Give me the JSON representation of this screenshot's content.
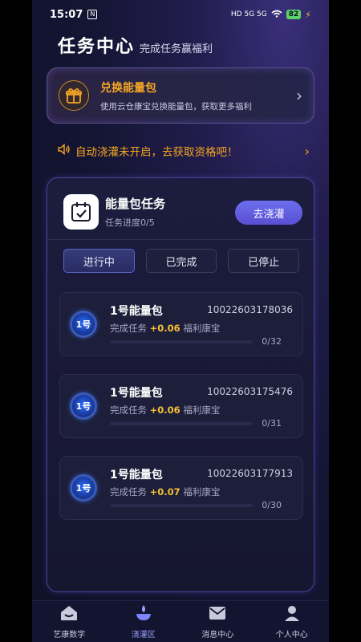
{
  "status": {
    "time": "15:07",
    "badge": "N",
    "signal": "HD 5G 5G",
    "battery": "82"
  },
  "header": {
    "title": "任务中心",
    "subtitle": "完成任务赢福利"
  },
  "exchange": {
    "title": "兑换能量包",
    "desc": "使用云仓康宝兑换能量包，获取更多福利"
  },
  "notice": {
    "text": "自动浇灌未开启，去获取资格吧！"
  },
  "task": {
    "title": "能量包任务",
    "progress": "任务进度0/5",
    "action": "去浇灌"
  },
  "tabs": [
    {
      "label": "进行中",
      "active": true
    },
    {
      "label": "已完成",
      "active": false
    },
    {
      "label": "已停止",
      "active": false
    }
  ],
  "items": [
    {
      "name": "1号能量包",
      "id": "10022603178036",
      "desc_prefix": "完成任务",
      "amount": "+0.06",
      "desc_suffix": "福利康宝",
      "progress": "0/32",
      "fraction": 0,
      "medal": "1号"
    },
    {
      "name": "1号能量包",
      "id": "10022603175476",
      "desc_prefix": "完成任务",
      "amount": "+0.06",
      "desc_suffix": "福利康宝",
      "progress": "0/31",
      "fraction": 0,
      "medal": "1号"
    },
    {
      "name": "1号能量包",
      "id": "10022603177913",
      "desc_prefix": "完成任务",
      "amount": "+0.07",
      "desc_suffix": "福利康宝",
      "progress": "0/30",
      "fraction": 0,
      "medal": "1号"
    }
  ],
  "nav": [
    {
      "label": "艺康数字",
      "icon": "home-icon",
      "active": false
    },
    {
      "label": "浇灌区",
      "icon": "water-icon",
      "active": true
    },
    {
      "label": "消息中心",
      "icon": "mail-icon",
      "active": false
    },
    {
      "label": "个人中心",
      "icon": "user-icon",
      "active": false
    }
  ],
  "colors": {
    "accent": "#f6a623",
    "primary": "#5a4fd2",
    "active_nav": "#9aa3ff"
  }
}
